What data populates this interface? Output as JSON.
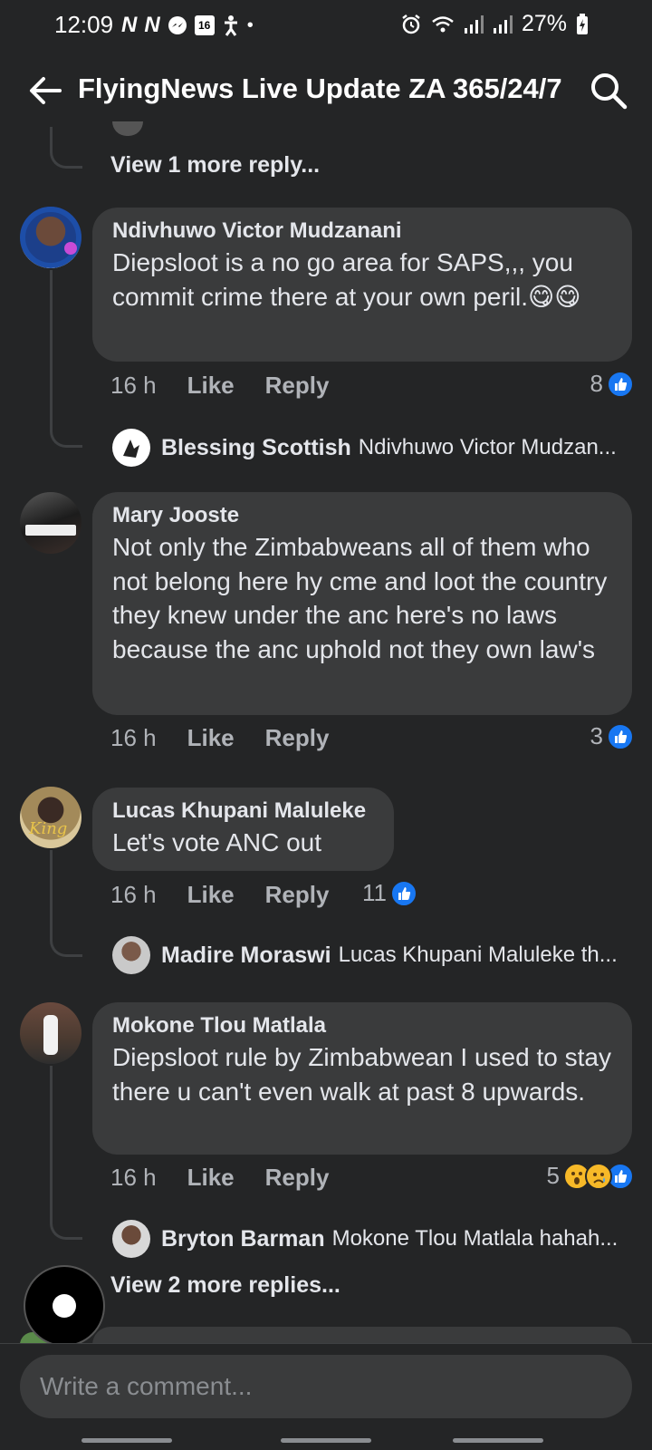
{
  "status_bar": {
    "time": "12:09",
    "left_icons": [
      "N",
      "N"
    ],
    "calendar_day": "16",
    "battery": "27%"
  },
  "header": {
    "title": "FlyingNews Live Update ZA 365/24/7"
  },
  "top_view_more": "View 1 more reply...",
  "comments": [
    {
      "author": "Ndivhuwo Victor Mudzanani",
      "text": "Diepsloot is a no go area for SAPS,,, you commit crime there at your own peril.😋😋",
      "time": "16 h",
      "like": "Like",
      "reply": "Reply",
      "reactions": "8",
      "reply_preview": {
        "name": "Blessing Scottish",
        "text": "Ndivhuwo Victor Mudzan..."
      }
    },
    {
      "author": "Mary Jooste",
      "text": "Not only the Zimbabweans all of them who not belong here hy cme and loot the country they knew under the anc here's no laws because the anc uphold not they own law's",
      "time": "16 h",
      "like": "Like",
      "reply": "Reply",
      "reactions": "3"
    },
    {
      "author": "Lucas Khupani Maluleke",
      "text": "Let's vote ANC out",
      "time": "16 h",
      "like": "Like",
      "reply": "Reply",
      "reactions": "11",
      "reply_preview": {
        "name": "Madire Moraswi",
        "text": "Lucas Khupani Maluleke th..."
      }
    },
    {
      "author": "Mokone Tlou Matlala",
      "text": "Diepsloot rule by Zimbabwean I used to stay there u can't even walk at past 8 upwards.",
      "time": "16 h",
      "like": "Like",
      "reply": "Reply",
      "reactions": "5",
      "reply_preview": {
        "name": "Bryton Barman",
        "text": "Mokone Tlou Matlala hahah..."
      },
      "view_more": "View 2 more replies..."
    }
  ],
  "composer": {
    "placeholder": "Write a comment..."
  },
  "colors": {
    "background": "#242526",
    "bubble": "#3a3b3c",
    "like_blue": "#1877f2",
    "meta_text": "#b0b3b8"
  }
}
